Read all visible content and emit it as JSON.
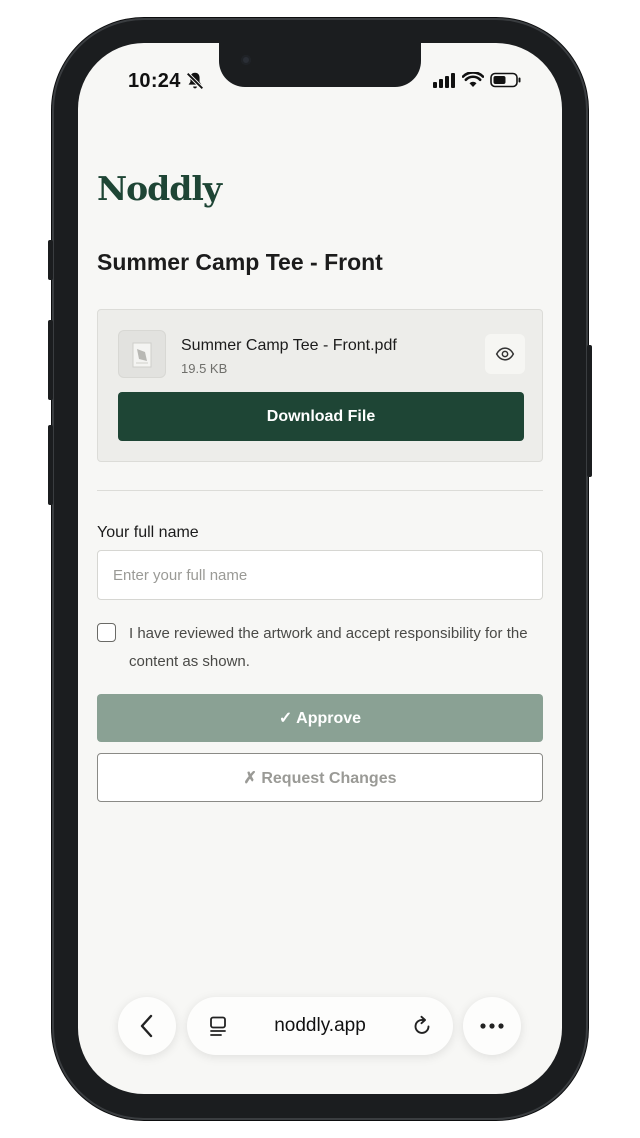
{
  "status_bar": {
    "time": "10:24",
    "icons": [
      "bell-slash-icon",
      "signal-icon",
      "wifi-icon",
      "battery-icon"
    ]
  },
  "app": {
    "logo": "Noddly",
    "brand_color": "#1e4535"
  },
  "page": {
    "title": "Summer Camp Tee - Front"
  },
  "file": {
    "name": "Summer Camp Tee - Front.pdf",
    "size": "19.5 KB",
    "download_label": "Download File",
    "preview_icon": "eye-icon"
  },
  "form": {
    "name_label": "Your full name",
    "name_placeholder": "Enter your full name",
    "name_value": "",
    "agreement_text": "I have reviewed the artwork and accept responsibility for the content as shown.",
    "agreement_checked": false,
    "approve_label": "✓ Approve",
    "request_changes_label": "✗ Request Changes",
    "approve_color": "#8aa194"
  },
  "browser": {
    "url": "noddly.app",
    "back_icon": "chevron-left-icon",
    "tabs_icon": "tab-overview-icon",
    "reload_icon": "reload-icon",
    "more_icon": "more-dots-icon"
  }
}
